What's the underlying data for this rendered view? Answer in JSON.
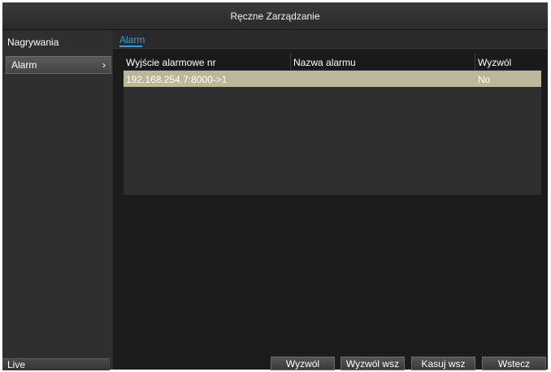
{
  "window": {
    "title": "Ręczne Zarządzanie"
  },
  "sidebar": {
    "header": "Nagrywania",
    "items": [
      {
        "label": "Alarm",
        "selected": true,
        "chevron": "›"
      }
    ],
    "live_label": "Live"
  },
  "main": {
    "tabs": [
      {
        "label": "Alarm",
        "active": true
      }
    ],
    "table": {
      "columns": [
        "Wyjście alarmowe nr",
        "Nazwa alarmu",
        "Wyzwól"
      ],
      "rows": [
        {
          "output": "192.168.254.7:8000->1",
          "name": "",
          "trigger": "No"
        }
      ]
    },
    "buttons": {
      "trigger": "Wyzwól",
      "trigger_all": "Wyzwól wsz",
      "clear_all": "Kasuj wsz",
      "back": "Wstecz"
    }
  },
  "colors": {
    "accent": "#27a3e8",
    "selected_row": "#bbb899",
    "background": "#1b1b1b"
  }
}
